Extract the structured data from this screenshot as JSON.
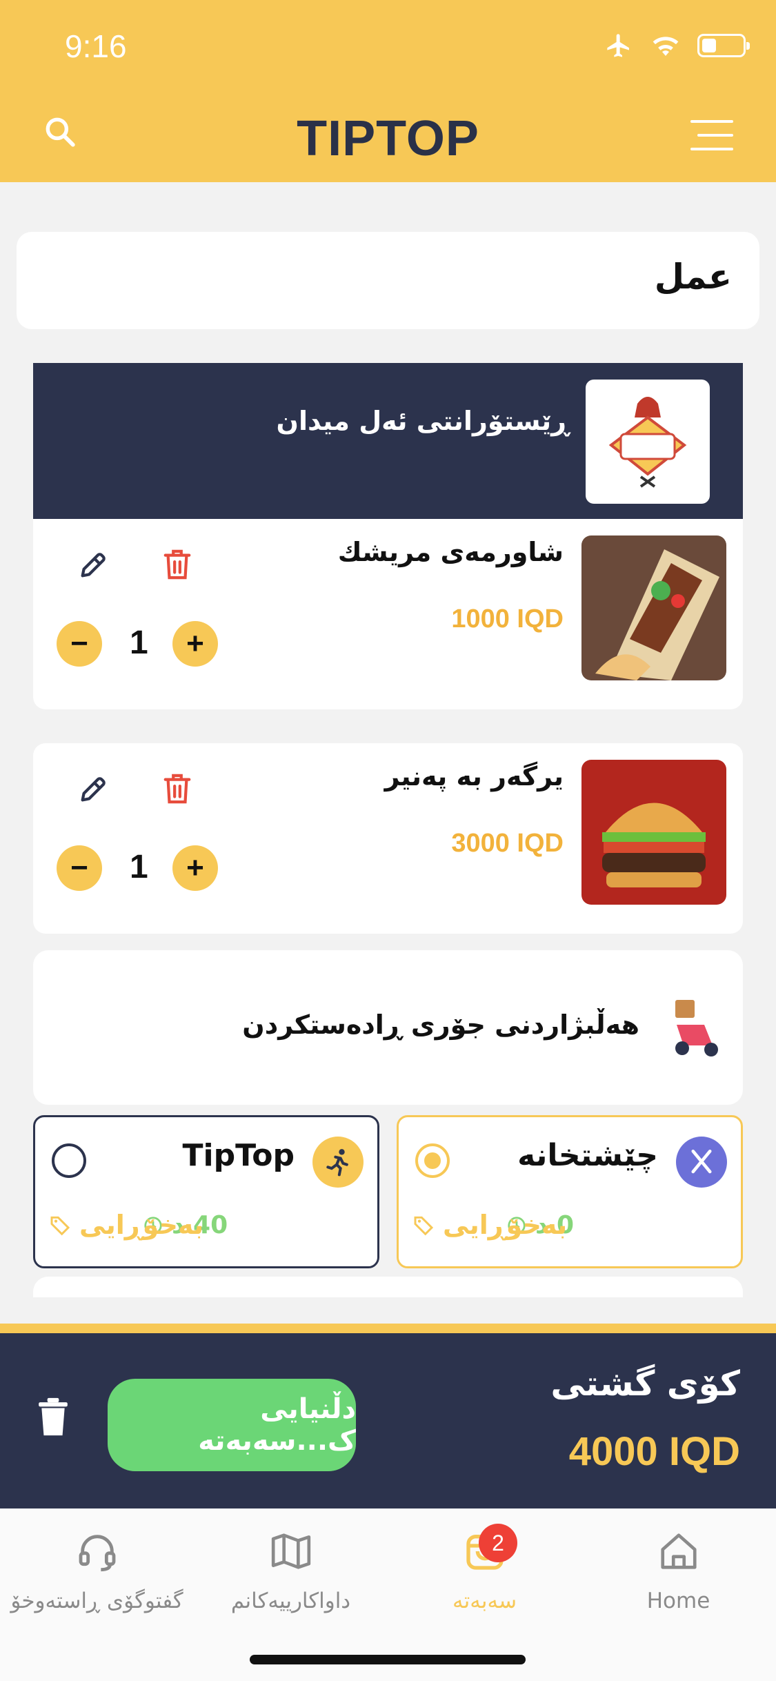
{
  "status": {
    "time": "9:16"
  },
  "header": {
    "logo": "TIPTOP"
  },
  "search": {
    "text": "عمل"
  },
  "restaurant": {
    "name": "ڕێستۆرانتی ئەل میدان",
    "logo_text": "الميدان"
  },
  "items": [
    {
      "title": "شاورمەی مریشك",
      "price": "1000 IQD",
      "qty": "1"
    },
    {
      "title": "یرگەر بە پەنیر",
      "price": "3000 IQD",
      "qty": "1"
    }
  ],
  "delivery": {
    "heading": "هەڵبژاردنی جۆری ڕادەستکردن",
    "options": [
      {
        "title": "TipTop",
        "time": "40 د",
        "fee": "بەخۆڕایی",
        "selected": false
      },
      {
        "title": "چێشتخانە",
        "time": "0 د",
        "fee": "بەخۆڕایی",
        "selected": true
      }
    ]
  },
  "summary": {
    "label": "کۆی گشتی",
    "total": "4000 IQD",
    "confirm": "دڵنیایی ک...سەبەتە"
  },
  "tabs": [
    {
      "label": "گفتوگۆی ڕاستەوخۆ"
    },
    {
      "label": "داواکارییەکانم"
    },
    {
      "label": "سەبەتە",
      "badge": "2"
    },
    {
      "label": "Home"
    }
  ],
  "colors": {
    "accent": "#f7c856",
    "navy": "#2c334d",
    "green": "#6bd676",
    "red": "#ee4036"
  }
}
